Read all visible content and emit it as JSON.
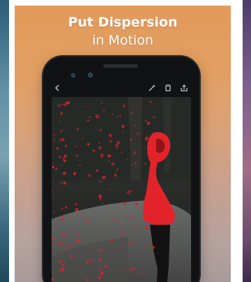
{
  "promo": {
    "headline_line1": "Put Dispersion",
    "headline_line2": "in Motion"
  },
  "toolbar": {
    "icons": [
      "back-icon",
      "brush-icon",
      "layers-icon",
      "share-icon"
    ]
  },
  "colors": {
    "card_top": "#e39a5a",
    "card_bottom": "#a89a9b",
    "hoodie_red": "#e3232a",
    "particle_red": "#d8232b"
  }
}
